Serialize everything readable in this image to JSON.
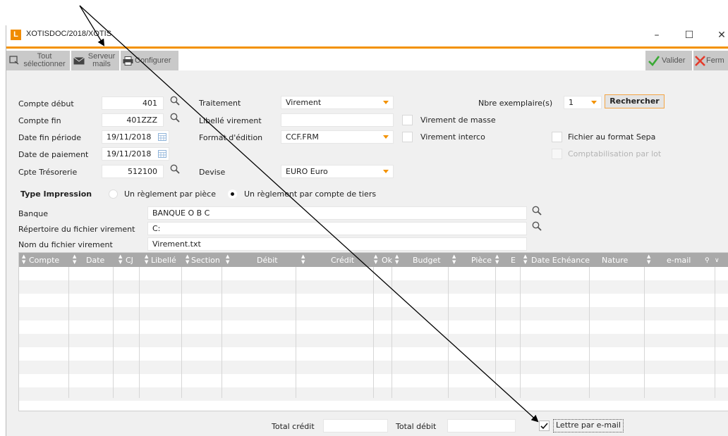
{
  "window": {
    "title": "XOTISDOC/2018/XOTIS",
    "logo_letter": "L"
  },
  "toolbar": {
    "select_all_line1": "Tout",
    "select_all_line2": "sélectionner",
    "mail_server_line1": "Serveur",
    "mail_server_line2": "mails",
    "configure": "Configurer",
    "validate": "Valider",
    "close": "Ferm"
  },
  "form": {
    "compte_debut": {
      "label": "Compte début",
      "value": "401"
    },
    "compte_fin": {
      "label": "Compte fin",
      "value": "401ZZZ"
    },
    "date_fin_periode": {
      "label": "Date fin période",
      "value": "19/11/2018"
    },
    "date_paiement": {
      "label": "Date de paiement",
      "value": "19/11/2018"
    },
    "cpte_tresorerie": {
      "label": "Cpte Trésorerie",
      "value": "512100"
    },
    "traitement": {
      "label": "Traitement",
      "value": "Virement"
    },
    "libelle_virement": {
      "label": "Libellé virement",
      "value": ""
    },
    "format_edition": {
      "label": "Format d'édition",
      "value": "CCF.FRM"
    },
    "devise": {
      "label": "Devise",
      "value": "EURO Euro"
    },
    "virement_masse": "Virement de masse",
    "virement_interco": "Virement interco",
    "nbre_exemplaires": {
      "label": "Nbre exemplaire(s)",
      "value": "1"
    },
    "rechercher": "Rechercher",
    "fichier_sepa": "Fichier au format Sepa",
    "compta_par_lot": "Comptabilisation par lot",
    "type_impression": {
      "label": "Type Impression",
      "option1": "Un règlement par pièce",
      "option2": "Un règlement par compte de tiers"
    },
    "banque": {
      "label": "Banque",
      "value": "BANQUE O B C"
    },
    "repertoire": {
      "label": "Répertoire du fichier virement",
      "value": "C:"
    },
    "nom_fichier": {
      "label": "Nom du fichier virement",
      "value": "Virement.txt"
    }
  },
  "grid": {
    "columns": [
      "Compte",
      "Date",
      "CJ",
      "Libellé",
      "Section",
      "Débit",
      "Crédit",
      "Ok",
      "Budget",
      "Pièce",
      "E",
      "Date Echéance",
      "Nature",
      "e-mail"
    ],
    "rows": []
  },
  "footer": {
    "total_credit": {
      "label": "Total crédit",
      "value": ""
    },
    "total_debit": {
      "label": "Total débit",
      "value": ""
    },
    "lettre_email": "Lettre par e-mail"
  },
  "colors": {
    "accent": "#f39200",
    "validate_green": "#3aa935",
    "close_red": "#e53a2a",
    "header_gray": "#a9a9a9"
  }
}
